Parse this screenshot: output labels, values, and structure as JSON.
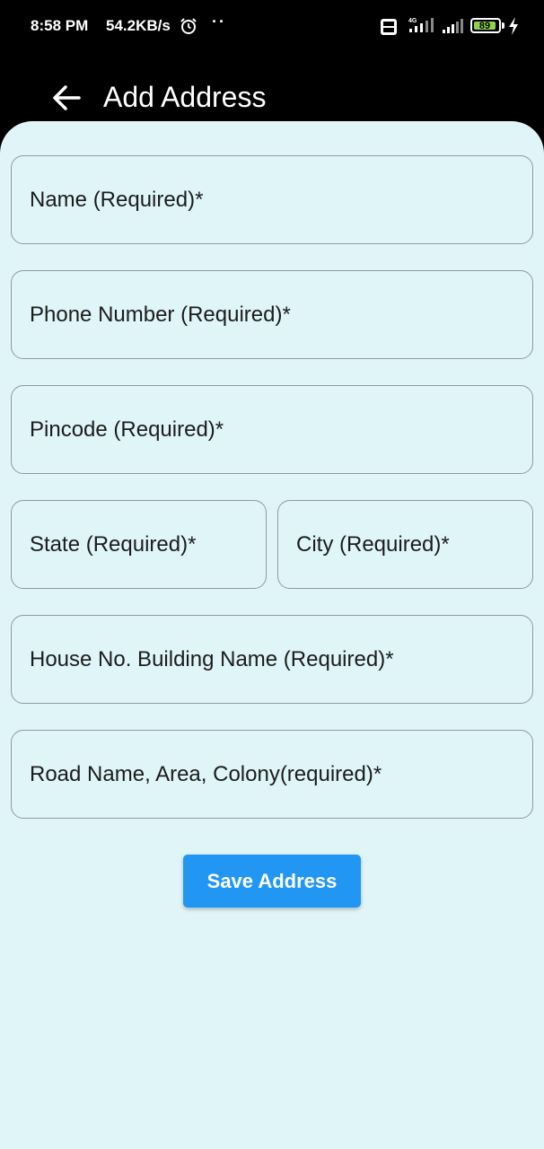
{
  "status_bar": {
    "time": "8:58 PM",
    "speed": "54.2KB/s",
    "dots": "··",
    "network": "4G",
    "battery": "89"
  },
  "app_bar": {
    "title": "Add Address"
  },
  "form": {
    "name_placeholder": "Name (Required)*",
    "phone_placeholder": "Phone Number (Required)*",
    "pincode_placeholder": "Pincode (Required)*",
    "state_placeholder": "State (Required)*",
    "city_placeholder": "City (Required)*",
    "house_placeholder": "House No. Building Name (Required)*",
    "road_placeholder": "Road Name, Area, Colony(required)*",
    "save_label": "Save Address"
  },
  "colors": {
    "background": "#dff5f8",
    "accent": "#2196f3",
    "battery": "#8fd14f"
  }
}
